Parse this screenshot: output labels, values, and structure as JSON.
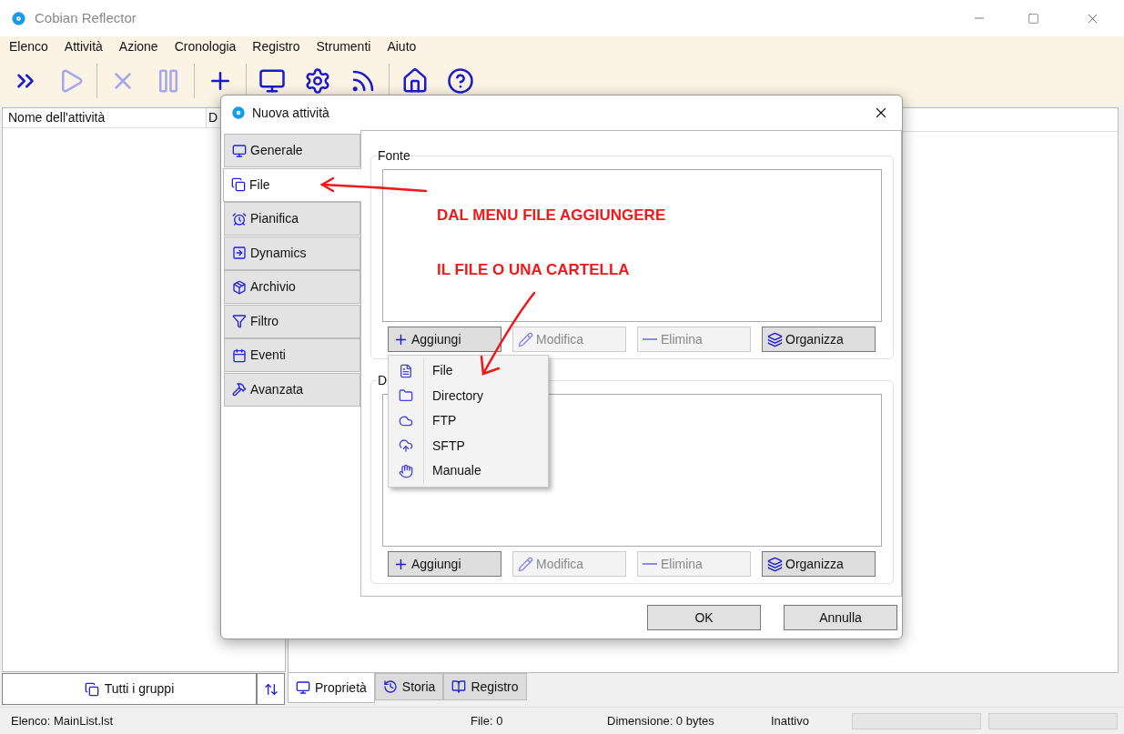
{
  "window": {
    "title": "Cobian Reflector"
  },
  "menu": [
    "Elenco",
    "Attività",
    "Azione",
    "Cronologia",
    "Registro",
    "Strumenti",
    "Aiuto"
  ],
  "toolbar": [
    [
      {
        "kind": "run-all",
        "disabled": false
      },
      {
        "kind": "run",
        "disabled": true
      }
    ],
    [
      {
        "kind": "stop",
        "disabled": true
      },
      {
        "kind": "pause",
        "disabled": true
      }
    ],
    [
      {
        "kind": "add",
        "disabled": false
      }
    ],
    [
      {
        "kind": "monitor",
        "disabled": false
      },
      {
        "kind": "settings",
        "disabled": false
      },
      {
        "kind": "signal",
        "disabled": false
      }
    ],
    [
      {
        "kind": "home",
        "disabled": false
      },
      {
        "kind": "help",
        "disabled": false
      }
    ]
  ],
  "task_list": {
    "columns": [
      "Nome dell'attività",
      "D"
    ]
  },
  "groups_button": "Tutti i gruppi",
  "bottom_tabs": [
    {
      "label": "Proprietà",
      "kind": "properties",
      "selected": true
    },
    {
      "label": "Storia",
      "kind": "history",
      "selected": false
    },
    {
      "label": "Registro",
      "kind": "log",
      "selected": false
    }
  ],
  "status_bar": {
    "list": "Elenco: MainList.lst",
    "files": "File: 0",
    "size": "Dimensione: 0 bytes",
    "state": "Inattivo"
  },
  "dialog": {
    "title": "Nuova attività",
    "sidebar": [
      {
        "label": "Generale",
        "kind": "general",
        "selected": false
      },
      {
        "label": "File",
        "kind": "file",
        "selected": true
      },
      {
        "label": "Pianifica",
        "kind": "schedule",
        "selected": false
      },
      {
        "label": "Dynamics",
        "kind": "dynamics",
        "selected": false
      },
      {
        "label": "Archivio",
        "kind": "archive",
        "selected": false
      },
      {
        "label": "Filtro",
        "kind": "filter",
        "selected": false
      },
      {
        "label": "Eventi",
        "kind": "events",
        "selected": false
      },
      {
        "label": "Avanzata",
        "kind": "advanced",
        "selected": false
      }
    ],
    "sections": [
      {
        "title": "Fonte",
        "buttons": [
          {
            "label": "Aggiungi",
            "kind": "add",
            "disabled": false
          },
          {
            "label": "Modifica",
            "kind": "edit",
            "disabled": true
          },
          {
            "label": "Elimina",
            "kind": "delete",
            "disabled": true
          },
          {
            "label": "Organizza",
            "kind": "organize",
            "disabled": false
          }
        ]
      },
      {
        "title": "D",
        "buttons": [
          {
            "label": "Aggiungi",
            "kind": "add",
            "disabled": false
          },
          {
            "label": "Modifica",
            "kind": "edit",
            "disabled": true
          },
          {
            "label": "Elimina",
            "kind": "delete",
            "disabled": true
          },
          {
            "label": "Organizza",
            "kind": "organize",
            "disabled": false
          }
        ]
      }
    ],
    "add_menu": [
      {
        "label": "File",
        "kind": "file"
      },
      {
        "label": "Directory",
        "kind": "directory"
      },
      {
        "label": "FTP",
        "kind": "ftp"
      },
      {
        "label": "SFTP",
        "kind": "sftp"
      },
      {
        "label": "Manuale",
        "kind": "manual"
      }
    ],
    "buttons": [
      "OK",
      "Annulla"
    ]
  },
  "annotations": [
    "DAL MENU FILE AGGIUNGERE",
    "IL FILE O UNA CARTELLA"
  ]
}
